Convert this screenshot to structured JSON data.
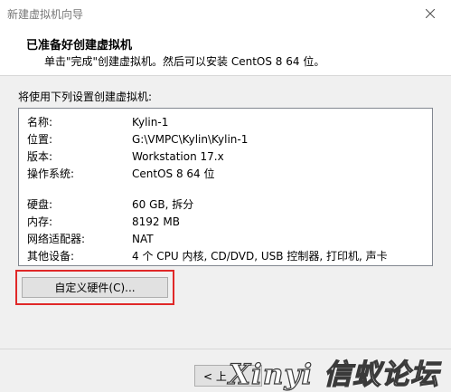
{
  "window": {
    "title": "新建虚拟机向导"
  },
  "header": {
    "title": "已准备好创建虚拟机",
    "subtitle": "单击\"完成\"创建虚拟机。然后可以安装 CentOS 8 64 位。"
  },
  "summary": {
    "label": "将使用下列设置创建虚拟机:",
    "rows": [
      {
        "key": "名称:",
        "value": "Kylin-1"
      },
      {
        "key": "位置:",
        "value": "G:\\VMPC\\Kylin\\Kylin-1"
      },
      {
        "key": "版本:",
        "value": "Workstation 17.x"
      },
      {
        "key": "操作系统:",
        "value": "CentOS 8 64 位"
      },
      {
        "key": "硬盘:",
        "value": "60 GB, 拆分"
      },
      {
        "key": "内存:",
        "value": "8192 MB"
      },
      {
        "key": "网络适配器:",
        "value": "NAT"
      },
      {
        "key": "其他设备:",
        "value": "4 个 CPU 内核, CD/DVD, USB 控制器, 打印机, 声卡"
      }
    ]
  },
  "buttons": {
    "customize": "自定义硬件(C)...",
    "back": "< 上"
  },
  "watermark": {
    "text": "Xinyi 信蚁论坛"
  },
  "colors": {
    "highlight": "#e02828"
  },
  "icons": {
    "close": "close-icon"
  }
}
